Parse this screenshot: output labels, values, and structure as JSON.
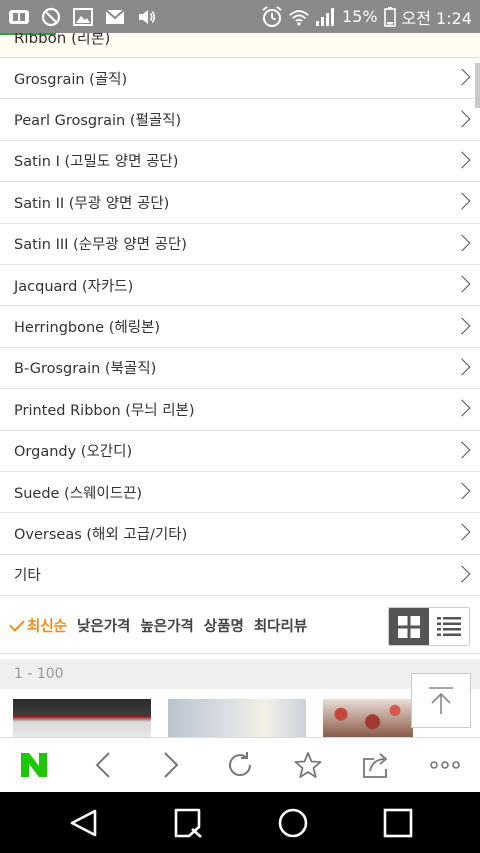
{
  "status_bar": {
    "battery": "15%",
    "time": "오전 1:24",
    "icons": [
      "app-icon",
      "no-disturb-icon",
      "image-icon",
      "mail-icon",
      "volume-icon",
      "alarm-icon",
      "wifi-icon",
      "signal-icon",
      "battery-icon"
    ]
  },
  "categories": {
    "partial_top": "Ribbon (리본)",
    "items": [
      "Grosgrain (골직)",
      "Pearl Grosgrain (펄골직)",
      "Satin I (고밀도 양면 공단)",
      "Satin II (무광 양면 공단)",
      "Satin III (순무광 양면 공단)",
      "Jacquard (자카드)",
      "Herringbone (헤링본)",
      "B-Grosgrain (북골직)",
      "Printed Ribbon (무늬 리본)",
      "Organdy (오간디)",
      "Suede (스웨이드끈)",
      "Overseas (해외 고급/기타)",
      "기타"
    ]
  },
  "sort": {
    "options": [
      "최신순",
      "낮은가격",
      "높은가격",
      "상품명",
      "최다리뷰"
    ],
    "active": "최신순",
    "view": "grid"
  },
  "range": "1 - 100",
  "colors": {
    "accent_orange": "#f28b13",
    "naver_green": "#1ec800",
    "status_bar": "#8a8a8a"
  },
  "browser_bar": {
    "icons": [
      "naver-home-icon",
      "back-icon",
      "forward-icon",
      "refresh-icon",
      "bookmark-star-icon",
      "share-icon",
      "more-icon"
    ]
  },
  "nav_bar": {
    "icons": [
      "nav-back-icon",
      "nav-recent-icon",
      "nav-home-icon",
      "nav-overview-icon"
    ]
  }
}
